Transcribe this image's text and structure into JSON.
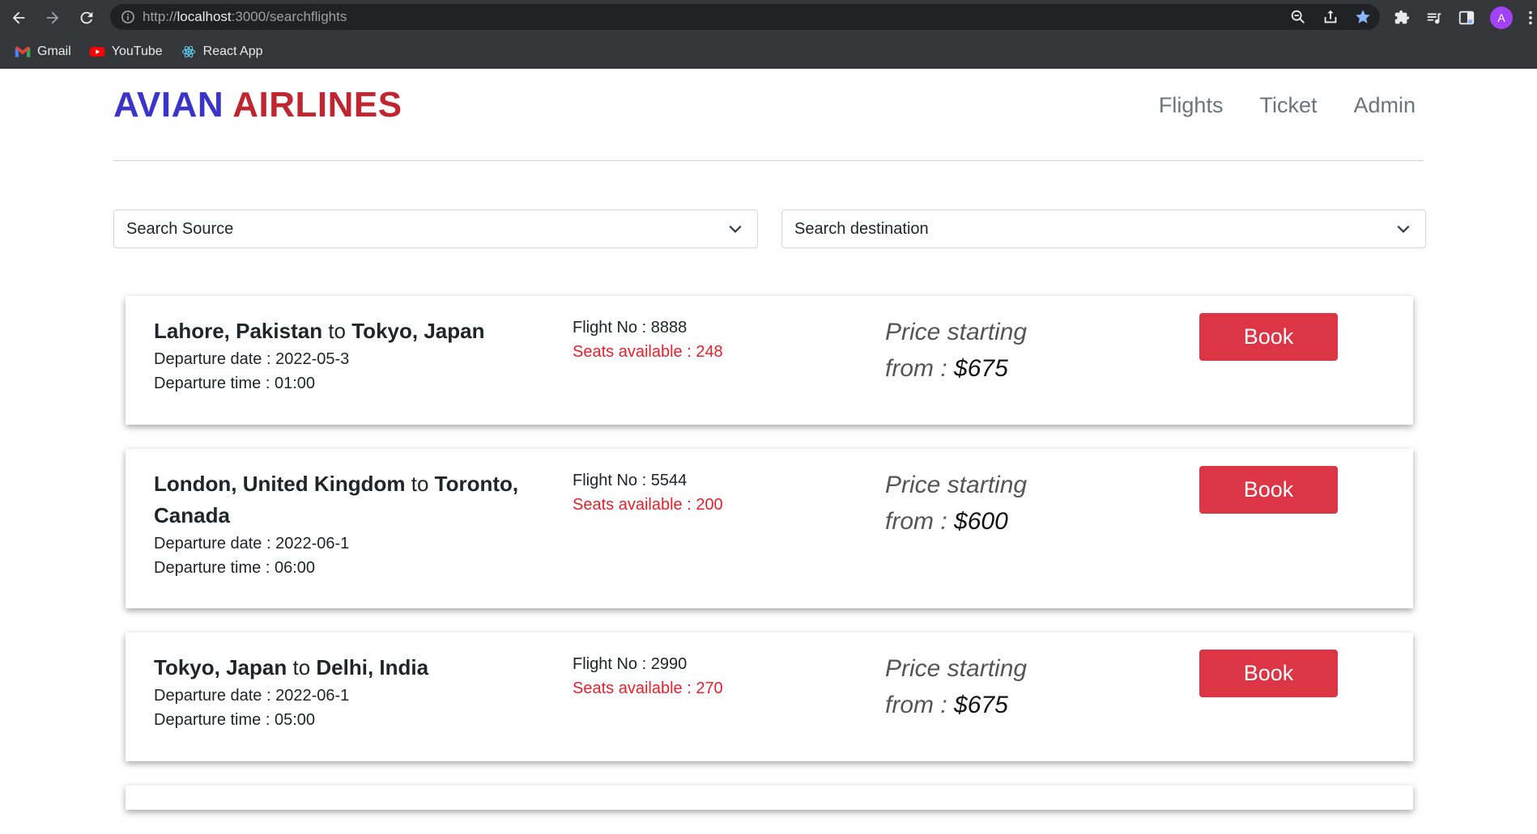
{
  "browser": {
    "url_scheme": "http://",
    "url_host": "localhost",
    "url_path": ":3000/searchflights",
    "avatar_letter": "A",
    "bookmarks": [
      {
        "label": "Gmail",
        "icon": "gmail-icon"
      },
      {
        "label": "YouTube",
        "icon": "youtube-icon"
      },
      {
        "label": "React App",
        "icon": "react-icon"
      }
    ]
  },
  "header": {
    "brand_part1": "AVIAN",
    "brand_part2": "AIRLINES",
    "nav": [
      "Flights",
      "Ticket",
      "Admin"
    ]
  },
  "filters": {
    "source_placeholder": "Search Source",
    "destination_placeholder": "Search destination"
  },
  "flights": [
    {
      "from": "Lahore, Pakistan",
      "connector": "to",
      "to": "Tokyo, Japan",
      "departure_date": "Departure date : 2022-05-3",
      "departure_time": "Departure time : 01:00",
      "flight_no": "Flight No : 8888",
      "seats": "Seats available : 248",
      "price_line1": "Price starting",
      "price_line2": "from : ",
      "price_amount": "$675",
      "book_label": "Book"
    },
    {
      "from": "London, United Kingdom",
      "connector": "to",
      "to": "Toronto, Canada",
      "departure_date": "Departure date : 2022-06-1",
      "departure_time": "Departure time : 06:00",
      "flight_no": "Flight No : 5544",
      "seats": "Seats available : 200",
      "price_line1": "Price starting",
      "price_line2": "from : ",
      "price_amount": "$600",
      "book_label": "Book"
    },
    {
      "from": "Tokyo, Japan",
      "connector": "to",
      "to": "Delhi, India",
      "departure_date": "Departure date : 2022-06-1",
      "departure_time": "Departure time : 05:00",
      "flight_no": "Flight No : 2990",
      "seats": "Seats available : 270",
      "price_line1": "Price starting",
      "price_line2": "from : ",
      "price_amount": "$675",
      "book_label": "Book"
    }
  ],
  "colors": {
    "brand_blue": "#3b34c9",
    "brand_red": "#c0262f",
    "book_button": "#dc3545",
    "seats_text": "#e3222c"
  }
}
